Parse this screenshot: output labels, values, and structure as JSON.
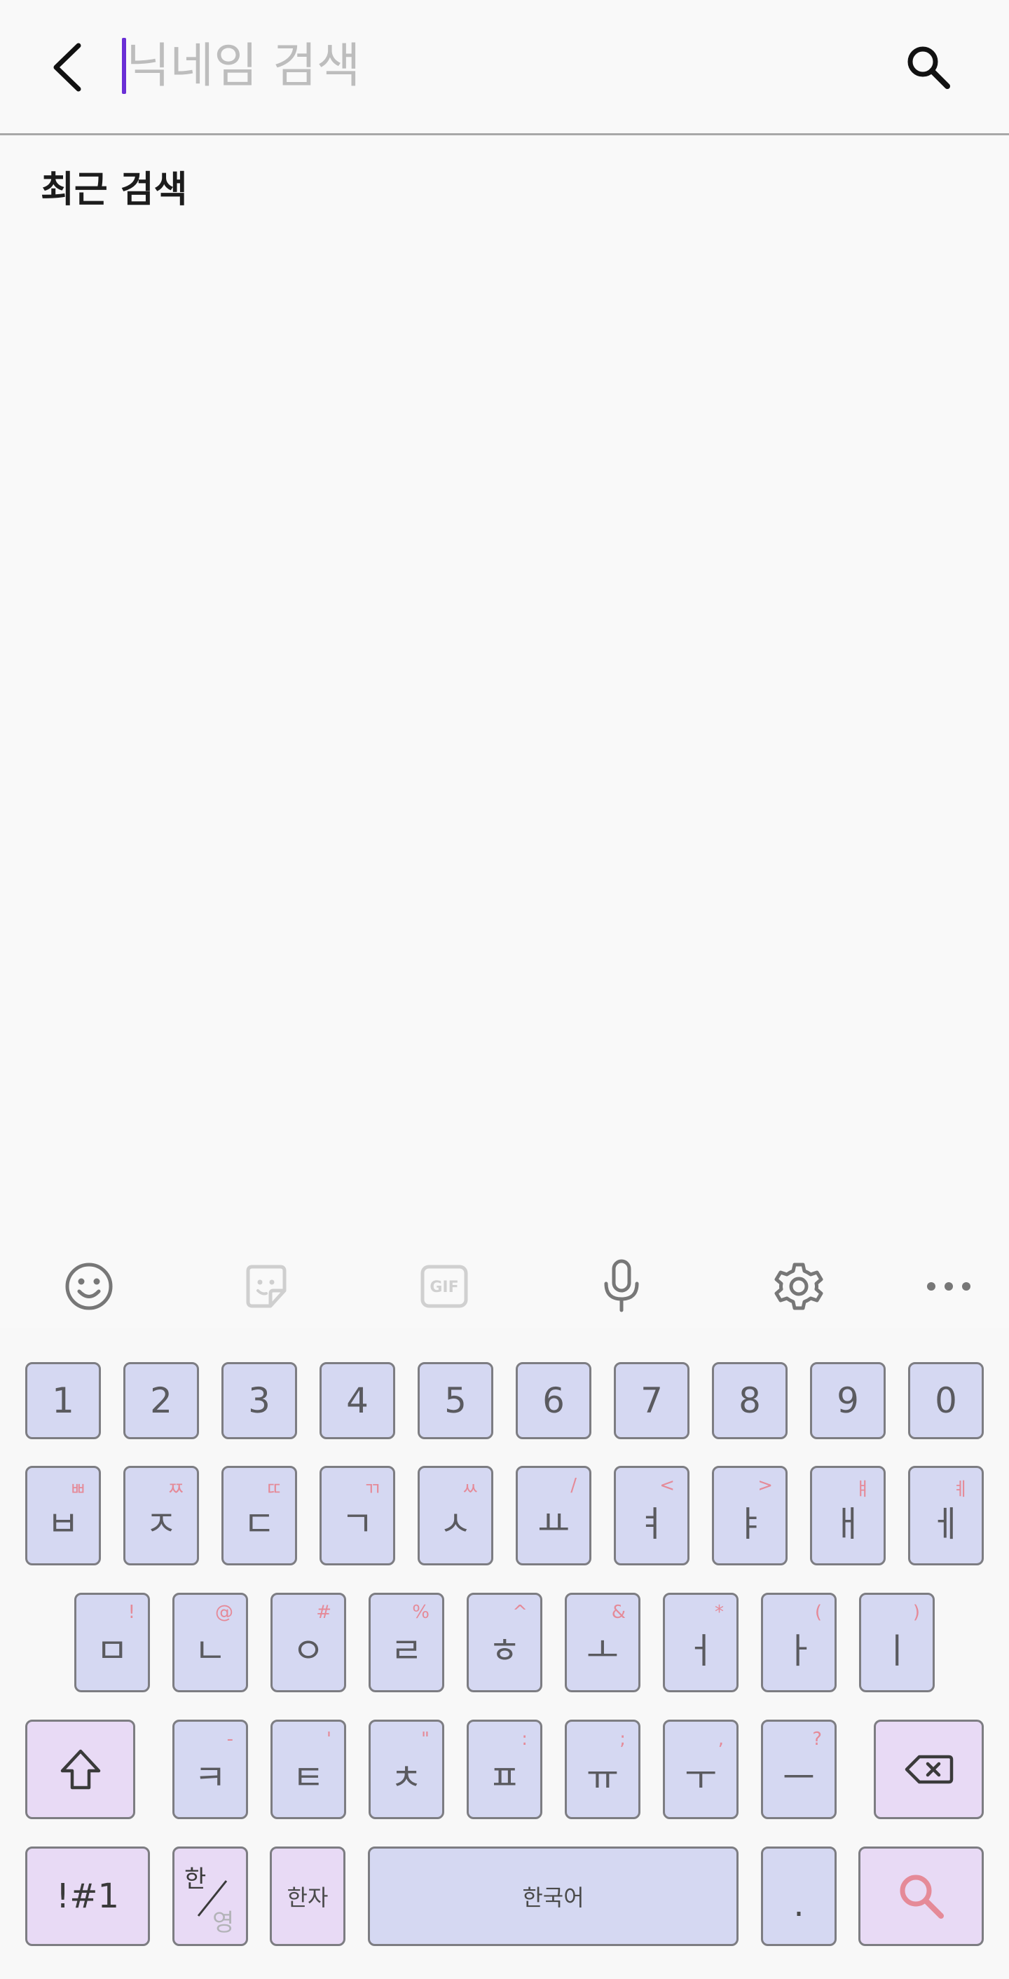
{
  "search": {
    "placeholder": "닉네임 검색"
  },
  "recent": {
    "title": "최근 검색"
  },
  "toolbar": {
    "items": [
      "emoji-icon",
      "sticker-icon",
      "gif-icon",
      "microphone-icon",
      "gear-icon",
      "more-icon"
    ],
    "gif_label": "GIF"
  },
  "keyboard": {
    "number_row": [
      "1",
      "2",
      "3",
      "4",
      "5",
      "6",
      "7",
      "8",
      "9",
      "0"
    ],
    "row1": [
      {
        "main": "ㅂ",
        "sub": "ㅃ"
      },
      {
        "main": "ㅈ",
        "sub": "ㅉ"
      },
      {
        "main": "ㄷ",
        "sub": "ㄸ"
      },
      {
        "main": "ㄱ",
        "sub": "ㄲ"
      },
      {
        "main": "ㅅ",
        "sub": "ㅆ"
      },
      {
        "main": "ㅛ",
        "sub": "/"
      },
      {
        "main": "ㅕ",
        "sub": "<"
      },
      {
        "main": "ㅑ",
        "sub": ">"
      },
      {
        "main": "ㅐ",
        "sub": "ㅒ"
      },
      {
        "main": "ㅔ",
        "sub": "ㅖ"
      }
    ],
    "row2": [
      {
        "main": "ㅁ",
        "sub": "!"
      },
      {
        "main": "ㄴ",
        "sub": "@"
      },
      {
        "main": "ㅇ",
        "sub": "#"
      },
      {
        "main": "ㄹ",
        "sub": "%"
      },
      {
        "main": "ㅎ",
        "sub": "^"
      },
      {
        "main": "ㅗ",
        "sub": "&"
      },
      {
        "main": "ㅓ",
        "sub": "*"
      },
      {
        "main": "ㅏ",
        "sub": "("
      },
      {
        "main": "ㅣ",
        "sub": ")"
      }
    ],
    "row3": [
      {
        "main": "ㅋ",
        "sub": "-"
      },
      {
        "main": "ㅌ",
        "sub": "'"
      },
      {
        "main": "ㅊ",
        "sub": "\""
      },
      {
        "main": "ㅍ",
        "sub": ":"
      },
      {
        "main": "ㅠ",
        "sub": ";"
      },
      {
        "main": "ㅜ",
        "sub": ","
      },
      {
        "main": "ㅡ",
        "sub": "?"
      }
    ],
    "symbols_label": "!#1",
    "lang_toggle_top": "한",
    "lang_toggle_bottom": "영",
    "hanja_label": "한자",
    "space_label": "한국어",
    "period_label": ".",
    "accent_color": "#e58a98",
    "key_color": "#d5d8f2",
    "special_key_color": "#e8daf5"
  }
}
